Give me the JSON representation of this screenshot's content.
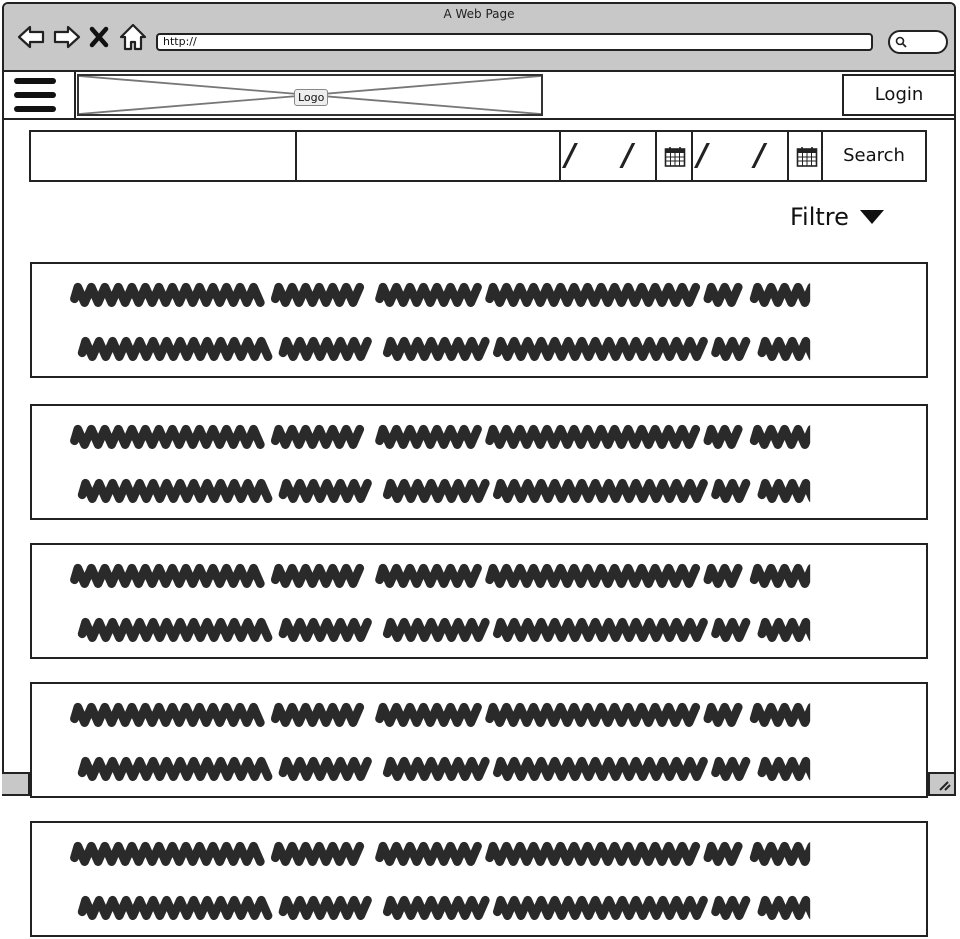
{
  "window": {
    "title": "A Web Page"
  },
  "address_bar": {
    "value": "http://"
  },
  "icons": {
    "back": "arrow-left-icon",
    "forward": "arrow-right-icon",
    "stop": "close-icon",
    "home": "home-icon",
    "search": "magnifier-icon",
    "menu": "hamburger-icon",
    "calendar": "calendar-icon",
    "dropdown": "triangle-down-icon",
    "resize": "resize-grip-icon"
  },
  "header": {
    "logo_label": "Logo",
    "login_label": "Login"
  },
  "search_form": {
    "field1_value": "",
    "field2_value": "",
    "date_start": "/ /",
    "date_end": "/ /",
    "search_label": "Search"
  },
  "filter": {
    "label": "Filtre"
  },
  "results": [
    {
      "id": "result-1"
    },
    {
      "id": "result-2"
    },
    {
      "id": "result-3"
    },
    {
      "id": "result-4"
    },
    {
      "id": "result-5"
    }
  ],
  "colors": {
    "chrome": "#c8c8c8",
    "ink": "#222222",
    "background": "#ffffff"
  }
}
